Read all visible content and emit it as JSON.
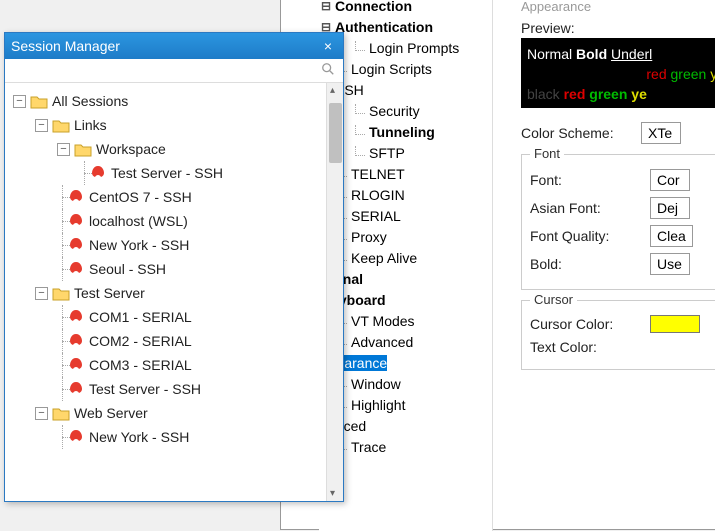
{
  "session_manager": {
    "title": "Session Manager",
    "close": "×",
    "search_placeholder": "",
    "tree": {
      "root": "All Sessions",
      "links": {
        "label": "Links",
        "workspace": {
          "label": "Workspace",
          "items": [
            "Test Server - SSH"
          ]
        },
        "items": [
          "CentOS 7 - SSH",
          "localhost (WSL)",
          "New York - SSH",
          "Seoul - SSH"
        ]
      },
      "test_server": {
        "label": "Test Server",
        "items": [
          "COM1 - SERIAL",
          "COM2 - SERIAL",
          "COM3 - SERIAL",
          "Test Server - SSH"
        ]
      },
      "web_server": {
        "label": "Web Server",
        "items": [
          "New York - SSH"
        ]
      }
    }
  },
  "settings_tree": {
    "connection": "Connection",
    "authentication": "Authentication",
    "login_prompts": "Login Prompts",
    "login_scripts": "Login Scripts",
    "ssh": "SSH",
    "security": "Security",
    "tunneling": "Tunneling",
    "sftp": "SFTP",
    "telnet": "TELNET",
    "rlogin": "RLOGIN",
    "serial": "SERIAL",
    "proxy": "Proxy",
    "keep_alive": "Keep Alive",
    "terminal": "rminal",
    "keyboard": "Keyboard",
    "vt_modes": "VT Modes",
    "advanced": "Advanced",
    "appearance": "ppearance",
    "window": "Window",
    "highlight": "Highlight",
    "advanced2": "vanced",
    "trace": "Trace"
  },
  "settings_panel": {
    "group_appearance": "Appearance",
    "preview_label": "Preview:",
    "preview_line1": {
      "normal": "Normal",
      "bold": "Bold",
      "underline": "Underl"
    },
    "preview_line2": {
      "red": "red",
      "green": "green",
      "yel": "ye"
    },
    "preview_line3": {
      "black": "black",
      "red": "red",
      "green": "green",
      "yel": "ye"
    },
    "color_scheme_label": "Color Scheme:",
    "color_scheme_value": "XTe",
    "font_group": "Font",
    "font_label": "Font:",
    "font_value": "Cor",
    "asian_font_label": "Asian Font:",
    "asian_font_value": "Dej",
    "font_quality_label": "Font Quality:",
    "font_quality_value": "Clea",
    "bold_label": "Bold:",
    "bold_value": "Use",
    "cursor_group": "Cursor",
    "cursor_color_label": "Cursor Color:",
    "text_color_label": "Text Color:"
  }
}
